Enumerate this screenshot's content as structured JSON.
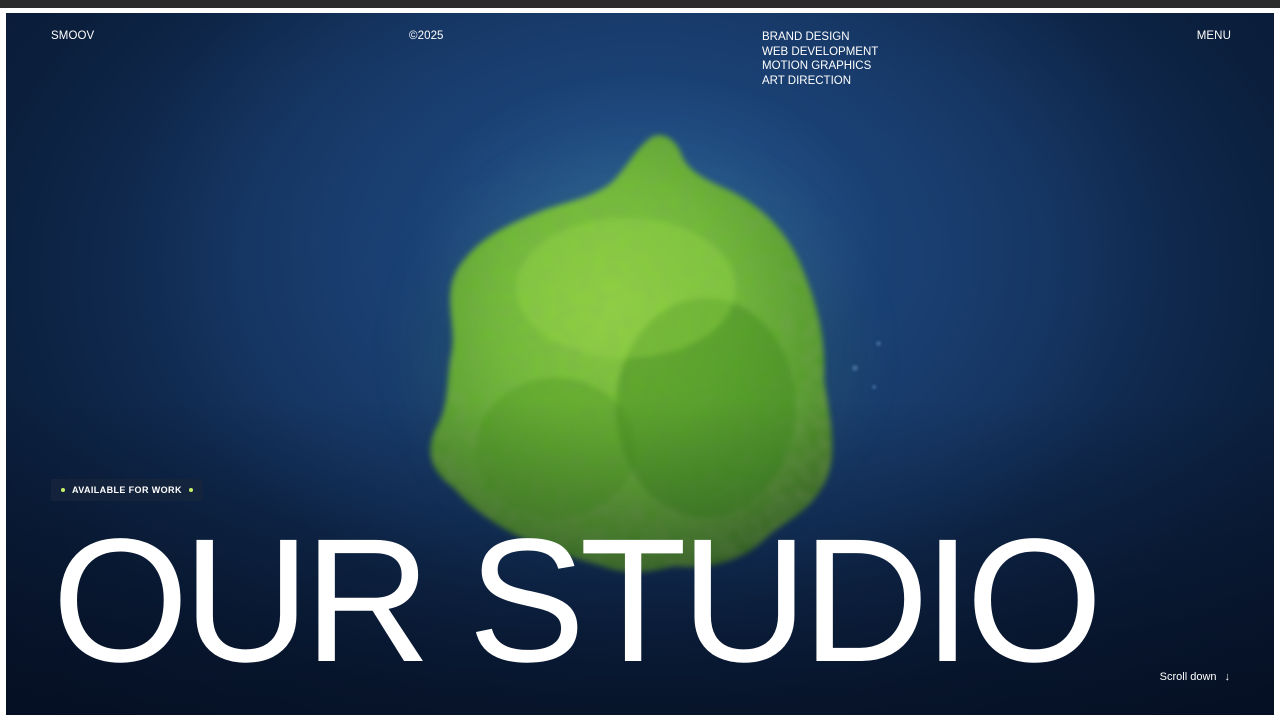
{
  "header": {
    "logo": "SMOOV",
    "copyright": "©2025",
    "services": [
      "BRAND DESIGN",
      "WEB DEVELOPMENT",
      "MOTION GRAPHICS",
      "ART DIRECTION"
    ],
    "menu_label": "MENU"
  },
  "hero": {
    "badge_label": "AVAILABLE FOR WORK",
    "title": "OUR STUDIO",
    "scroll_label": "Scroll down",
    "scroll_icon": "↓"
  },
  "colors": {
    "background": "#13305a",
    "blob": "#6fbf2e",
    "badge_dot": "#c6f06a",
    "text": "#ffffff"
  },
  "icons": {
    "scroll": "arrow-down-icon",
    "badge": "status-dot-icon"
  }
}
